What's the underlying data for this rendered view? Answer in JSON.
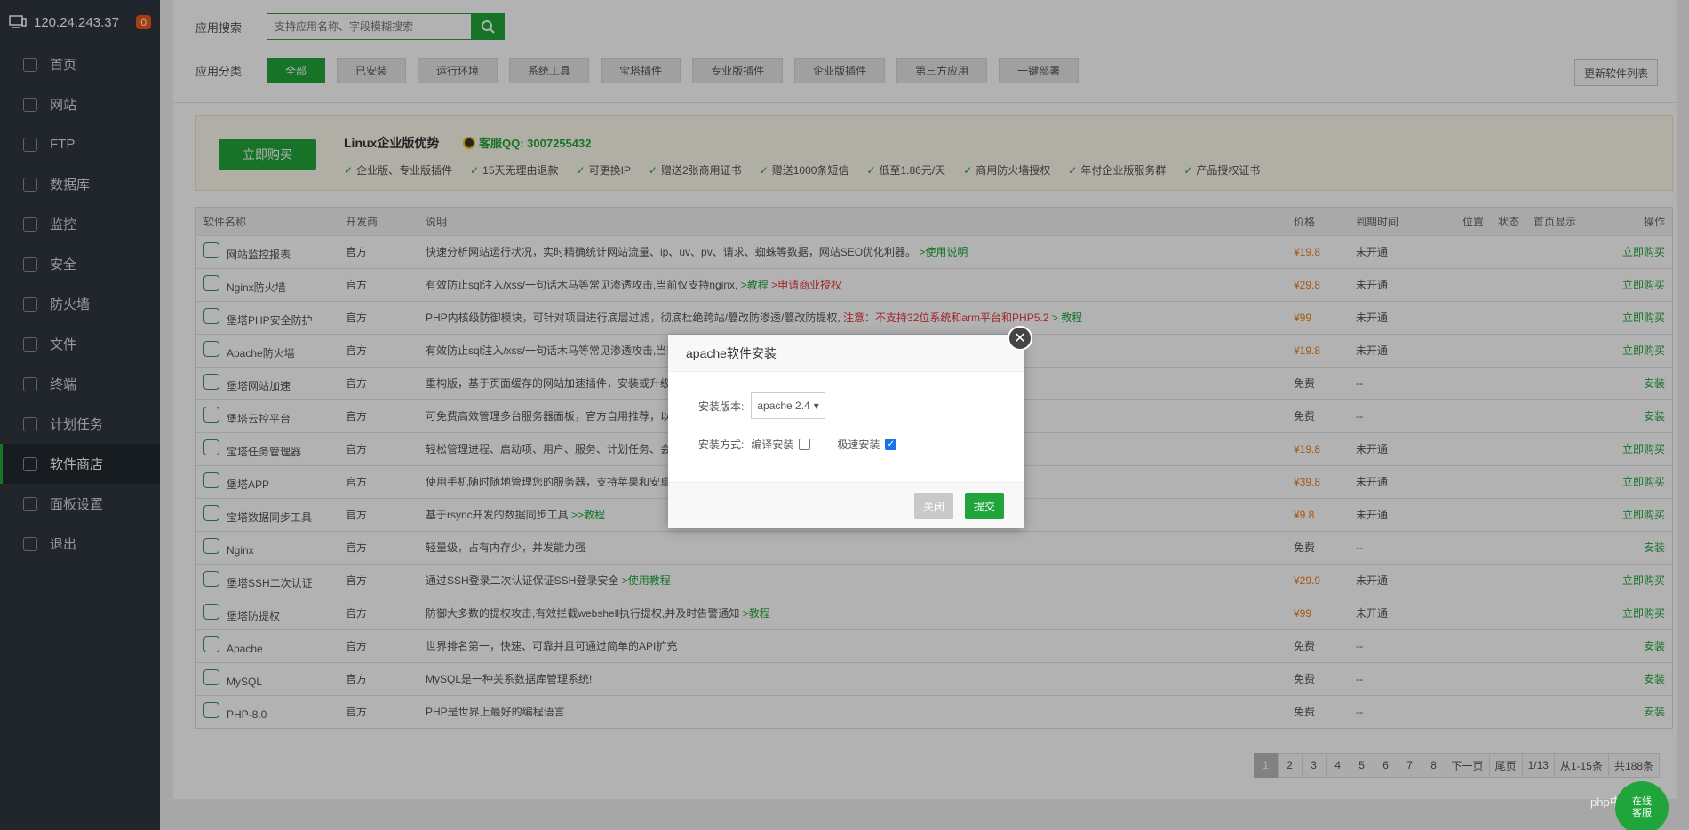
{
  "sidebar": {
    "server_ip": "120.24.243.37",
    "badge": "0",
    "items": [
      {
        "label": "首页",
        "icon": "home-icon"
      },
      {
        "label": "网站",
        "icon": "globe-icon"
      },
      {
        "label": "FTP",
        "icon": "ftp-icon"
      },
      {
        "label": "数据库",
        "icon": "database-icon"
      },
      {
        "label": "监控",
        "icon": "monitor-icon"
      },
      {
        "label": "安全",
        "icon": "shield-icon"
      },
      {
        "label": "防火墙",
        "icon": "firewall-icon"
      },
      {
        "label": "文件",
        "icon": "folder-icon"
      },
      {
        "label": "终端",
        "icon": "terminal-icon"
      },
      {
        "label": "计划任务",
        "icon": "calendar-icon"
      },
      {
        "label": "软件商店",
        "icon": "grid-icon"
      },
      {
        "label": "面板设置",
        "icon": "settings-icon"
      },
      {
        "label": "退出",
        "icon": "logout-icon"
      }
    ]
  },
  "search": {
    "label": "应用搜索",
    "placeholder": "支持应用名称、字段模糊搜索"
  },
  "category": {
    "label": "应用分类",
    "items": [
      "全部",
      "已安装",
      "运行环境",
      "系统工具",
      "宝塔插件",
      "专业版插件",
      "企业版插件",
      "第三方应用",
      "一键部署"
    ]
  },
  "update_button": "更新软件列表",
  "promo": {
    "buy_button": "立即购买",
    "title": "Linux企业版优势",
    "qq": "客服QQ: 3007255432",
    "features": [
      "企业版、专业版插件",
      "15天无理由退款",
      "可更换IP",
      "赠送2张商用证书",
      "赠送1000条短信",
      "低至1.86元/天",
      "商用防火墙授权",
      "年付企业版服务群",
      "产品授权证书"
    ]
  },
  "table": {
    "headers": {
      "name": "软件名称",
      "dev": "开发商",
      "desc": "说明",
      "price": "价格",
      "expire": "到期时间",
      "pos": "位置",
      "status": "状态",
      "home": "首页显示",
      "op": "操作"
    },
    "rows": [
      {
        "name": "网站监控报表",
        "dev": "官方",
        "desc": "快速分析网站运行状况，实时精确统计网站流量、ip、uv、pv、请求、蜘蛛等数据，网站SEO优化利器。",
        "link": ">使用说明",
        "link2": "",
        "warn": "",
        "price": "¥19.8",
        "expire": "未开通",
        "op": "立即购买"
      },
      {
        "name": "Nginx防火墙",
        "dev": "官方",
        "desc": "有效防止sql注入/xss/一句话木马等常见渗透攻击,当前仅支持nginx,",
        "link": ">教程",
        "link2": "",
        "warn": ">申请商业授权",
        "price": "¥29.8",
        "expire": "未开通",
        "op": "立即购买"
      },
      {
        "name": "堡塔PHP安全防护",
        "dev": "官方",
        "desc": "PHP内核级防御模块，可针对项目进行底层过滤，彻底杜绝跨站/篡改防渗透/篡改防提权,",
        "link": "",
        "link2": "> 教程",
        "warn": "注意：不支持32位系统和arm平台和PHP5.2",
        "price": "¥99",
        "expire": "未开通",
        "op": "立即购买"
      },
      {
        "name": "Apache防火墙",
        "dev": "官方",
        "desc": "有效防止sql注入/xss/一句话木马等常见渗透攻击,当前仅支持apache,",
        "link": "",
        "link2": "",
        "warn": "",
        "price": "¥19.8",
        "expire": "未开通",
        "op": "立即购买"
      },
      {
        "name": "堡塔网站加速",
        "dev": "官方",
        "desc": "重构版，基于页面缓存的网站加速插件，安装或升级",
        "link": "",
        "link2": "",
        "warn": "",
        "price": "免费",
        "expire": "--",
        "op": "安装"
      },
      {
        "name": "堡塔云控平台",
        "dev": "官方",
        "desc": "可免费高效管理多台服务器面板，官方自用推荐，以",
        "link": "",
        "link2": "",
        "warn": "",
        "price": "免费",
        "expire": "--",
        "op": "安装"
      },
      {
        "name": "宝塔任务管理器",
        "dev": "官方",
        "desc": "轻松管理进程、启动项、用户、服务、计划任务、会",
        "link": "",
        "link2": "",
        "warn": "",
        "price": "¥19.8",
        "expire": "未开通",
        "op": "立即购买"
      },
      {
        "name": "堡塔APP",
        "dev": "官方",
        "desc": "使用手机随时随地管理您的服务器，支持苹果和安卓",
        "link": "",
        "link2": "",
        "warn": "",
        "price": "¥39.8",
        "expire": "未开通",
        "op": "立即购买"
      },
      {
        "name": "宝塔数据同步工具",
        "dev": "官方",
        "desc": "基于rsync开发的数据同步工具",
        "link": ">>教程",
        "link2": "",
        "warn": "",
        "price": "¥9.8",
        "expire": "未开通",
        "op": "立即购买"
      },
      {
        "name": "Nginx",
        "dev": "官方",
        "desc": "轻量级，占有内存少，并发能力强",
        "link": "",
        "link2": "",
        "warn": "",
        "price": "免费",
        "expire": "--",
        "op": "安装"
      },
      {
        "name": "堡塔SSH二次认证",
        "dev": "官方",
        "desc": "通过SSH登录二次认证保证SSH登录安全",
        "link": ">使用教程",
        "link2": "",
        "warn": "",
        "price": "¥29.9",
        "expire": "未开通",
        "op": "立即购买"
      },
      {
        "name": "堡塔防提权",
        "dev": "官方",
        "desc": "防御大多数的提权攻击,有效拦截webshell执行提权,并及时告警通知",
        "link": ">教程",
        "link2": "",
        "warn": "",
        "price": "¥99",
        "expire": "未开通",
        "op": "立即购买"
      },
      {
        "name": "Apache",
        "dev": "官方",
        "desc": "世界排名第一，快速、可靠并且可通过简单的API扩充",
        "link": "",
        "link2": "",
        "warn": "",
        "price": "免费",
        "expire": "--",
        "op": "安装"
      },
      {
        "name": "MySQL",
        "dev": "官方",
        "desc": "MySQL是一种关系数据库管理系统!",
        "link": "",
        "link2": "",
        "warn": "",
        "price": "免费",
        "expire": "--",
        "op": "安装"
      },
      {
        "name": "PHP-8.0",
        "dev": "官方",
        "desc": "PHP是世界上最好的编程语言",
        "link": "",
        "link2": "",
        "warn": "",
        "price": "免费",
        "expire": "--",
        "op": "安装"
      }
    ]
  },
  "pager": {
    "pages": [
      "1",
      "2",
      "3",
      "4",
      "5",
      "6",
      "7",
      "8"
    ],
    "next": "下一页",
    "last": "尾页",
    "page_info": "1/13",
    "range": "从1-15条",
    "total": "共188条"
  },
  "modal": {
    "title": "apache软件安装",
    "version_label": "安装版本:",
    "version_value": "apache 2.4",
    "method_label": "安装方式:",
    "compile_label": "编译安装",
    "fast_label": "极速安装",
    "close_button": "关闭",
    "submit_button": "提交"
  },
  "kefu": "在线\n客服",
  "watermark": "php中文网",
  "colors": {
    "accent": "#20a53a",
    "sidebar": "#2f3740",
    "price": "#ef7f1a",
    "warn": "#e4393c"
  }
}
